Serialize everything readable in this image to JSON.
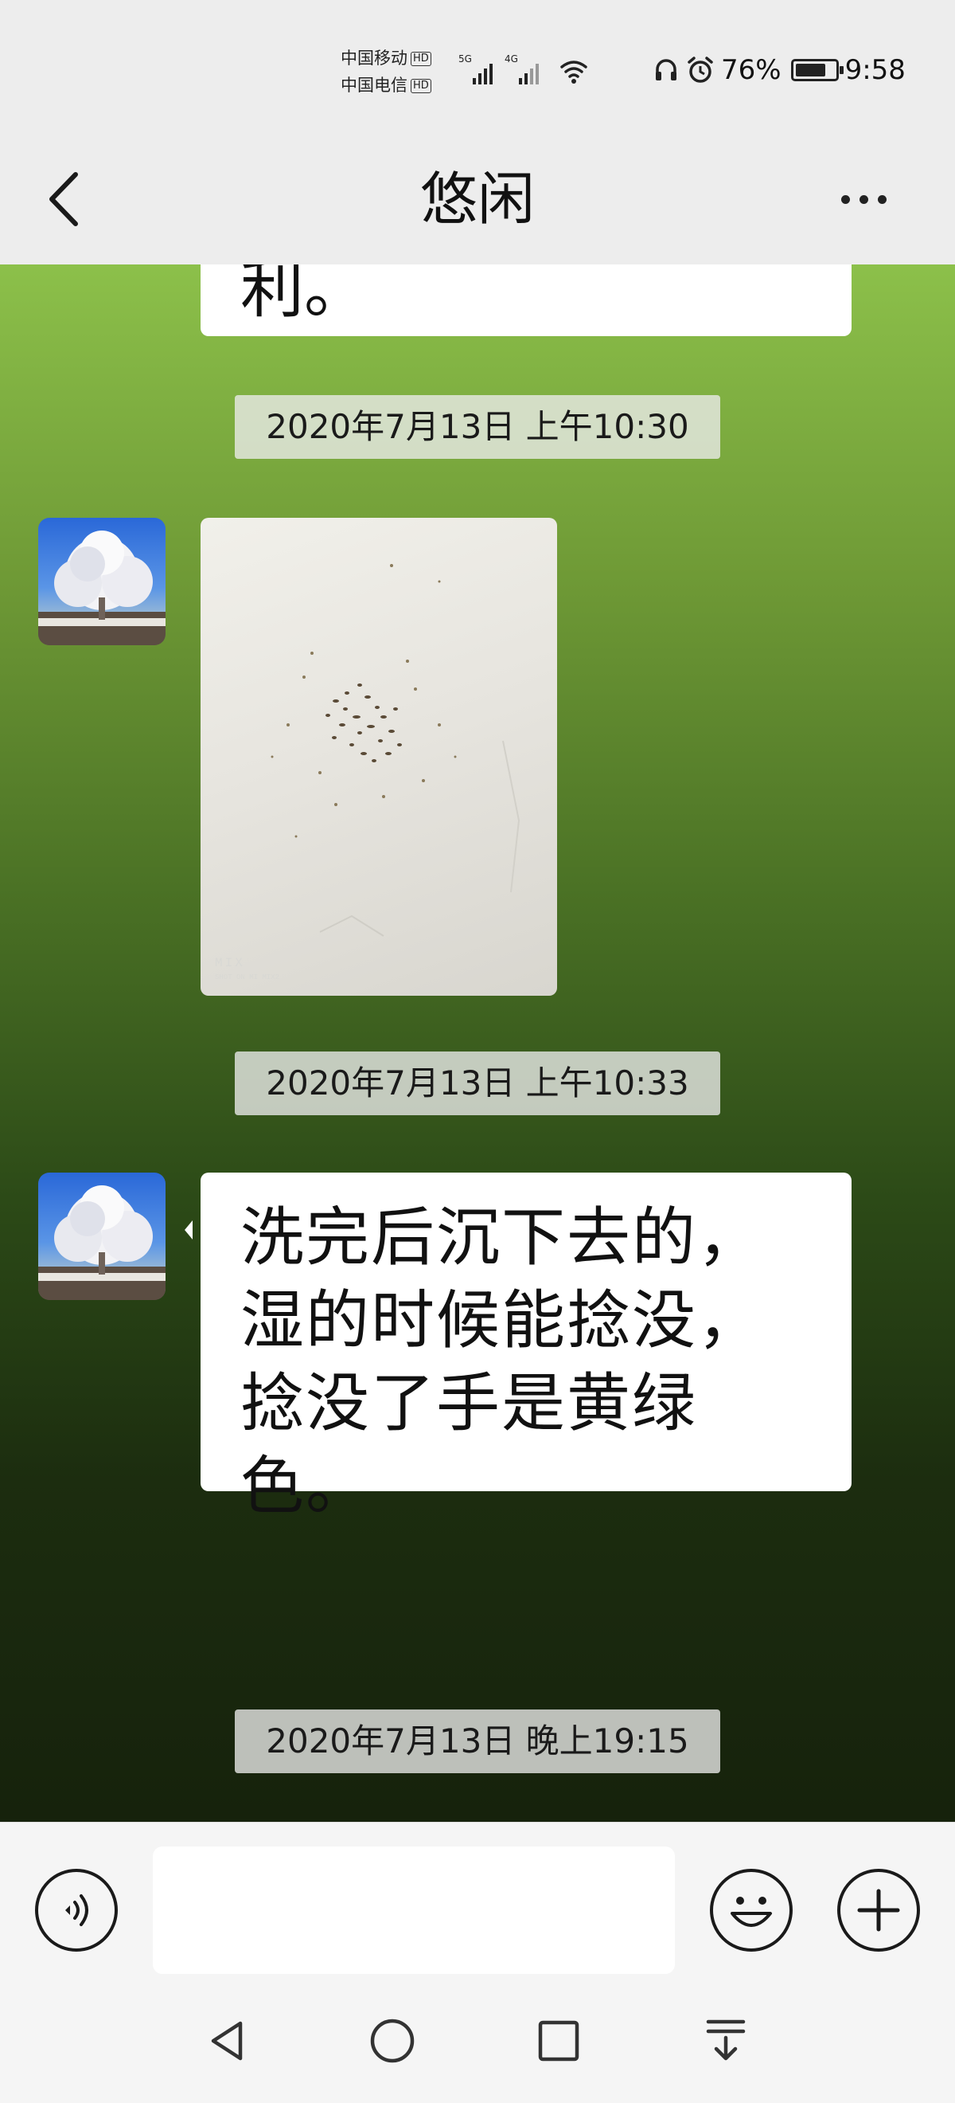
{
  "status_bar": {
    "carrier_1": "中国移动",
    "carrier_2": "中国电信",
    "hd_badge": "HD",
    "network_1": "5G",
    "network_2": "4G",
    "battery_percent": "76%",
    "time": "9:58",
    "icons": [
      "signal-icon",
      "wifi-icon",
      "headphone-icon",
      "alarm-icon",
      "battery-icon"
    ]
  },
  "header": {
    "title": "悠闲",
    "back_icon": "chevron-left-icon",
    "more_icon": "more-dots-icon"
  },
  "chat": {
    "background_colors": [
      "#8cc04a",
      "#16220c"
    ],
    "messages": [
      {
        "type": "text",
        "text": "利。"
      },
      {
        "type": "timestamp",
        "text": "2020年7月13日 上午10:30"
      },
      {
        "type": "image",
        "watermark": "MIX",
        "watermark_sub": "SHOT ON MI MIX2"
      },
      {
        "type": "timestamp",
        "text": "2020年7月13日 上午10:33"
      },
      {
        "type": "text",
        "text": "洗完后沉下去的，湿的时候能捻没，捻没了手是黄绿色。"
      },
      {
        "type": "timestamp",
        "text": "2020年7月13日 晚上19:15"
      }
    ]
  },
  "input_bar": {
    "value": "",
    "icons": [
      "voice-icon",
      "emoji-icon",
      "plus-icon"
    ]
  },
  "nav_bar": {
    "icons": [
      "back-triangle-icon",
      "home-circle-icon",
      "recents-square-icon",
      "notification-pull-icon"
    ]
  }
}
